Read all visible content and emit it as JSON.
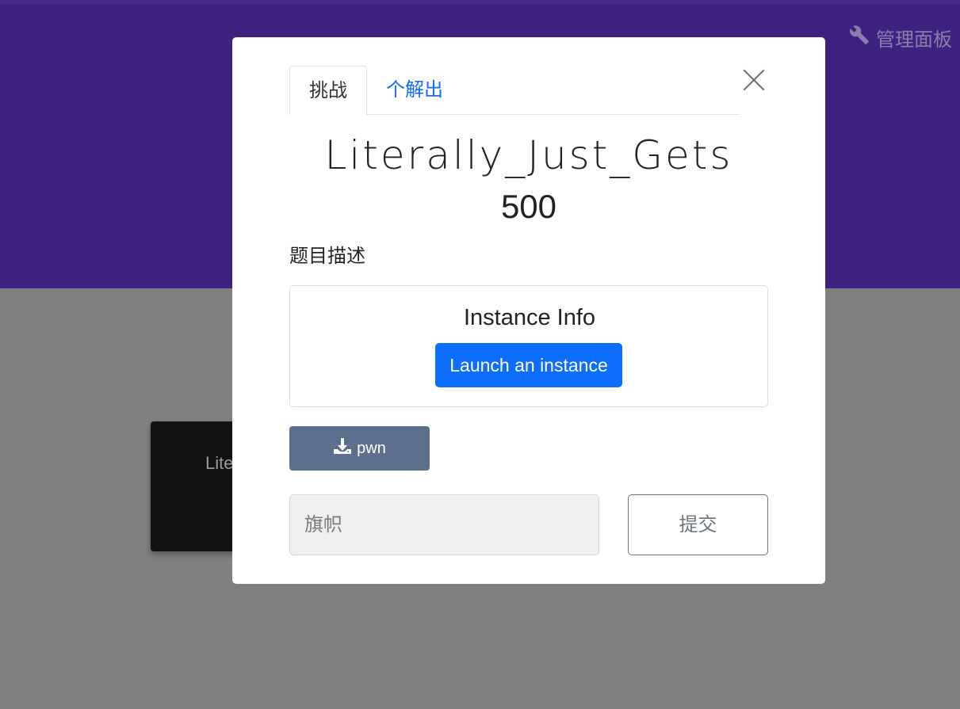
{
  "header": {
    "admin_label": "管理面板",
    "admin_icon": "wrench-icon"
  },
  "background_card": {
    "title": "Lite"
  },
  "modal": {
    "tabs": [
      {
        "label": "挑战",
        "active": true
      },
      {
        "label": "个解出",
        "active": false
      }
    ],
    "challenge_name": "Literally_Just_Gets",
    "points": "500",
    "description_label": "题目描述",
    "instance": {
      "title": "Instance Info",
      "launch_label": "Launch an instance"
    },
    "file": {
      "label": "pwn",
      "icon": "download-icon"
    },
    "flag": {
      "placeholder": "旗帜",
      "value": ""
    },
    "submit_label": "提交"
  },
  "colors": {
    "accent": "#0d6efd",
    "hero": "#3f2180",
    "file_button": "#5c6f8c"
  }
}
